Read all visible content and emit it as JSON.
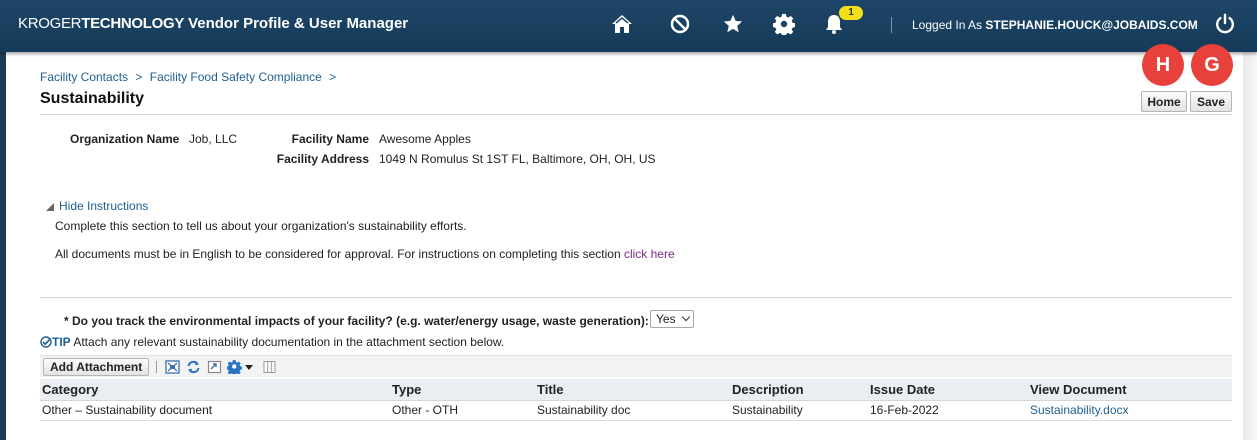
{
  "header": {
    "brand_kroger": "KROGER",
    "brand_tech": "TECHNOLOGY",
    "app_title": "Vendor Profile & User Manager",
    "notification_count": "1",
    "logged_in_label": "Logged In As",
    "user": "STEPHANIE.HOUCK@JOBAIDS.COM",
    "icons": [
      "home-icon",
      "no-entry-icon",
      "star-icon",
      "gear-icon",
      "bell-icon",
      "power-icon"
    ],
    "color": "#1e4668"
  },
  "breadcrumb": {
    "items": [
      "Facility Contacts",
      "Facility Food Safety Compliance"
    ],
    "separator": ">"
  },
  "page": {
    "title": "Sustainability"
  },
  "markers": {
    "home": "H",
    "save": "G",
    "color": "#e8403a"
  },
  "buttons": {
    "home": "Home",
    "save": "Save"
  },
  "info": {
    "org_name_label": "Organization Name",
    "org_name": "Job, LLC",
    "facility_name_label": "Facility Name",
    "facility_name": "Awesome Apples",
    "facility_address_label": "Facility Address",
    "facility_address": "1049 N Romulus St 1ST FL, Baltimore, OH, OH, US"
  },
  "instructions": {
    "toggle": "Hide Instructions",
    "line1": "Complete this section to tell us about your organization's sustainability efforts.",
    "line2": "All documents must be in English to be considered for approval. For instructions on completing this section",
    "link": "click here"
  },
  "question": {
    "text": "* Do you track the environmental impacts of your facility? (e.g. water/energy usage, waste generation):",
    "selected": "Yes"
  },
  "tip": {
    "label": "TIP",
    "text": "Attach any relevant sustainability documentation in the attachment section below."
  },
  "toolbar": {
    "add_attachment": "Add Attachment",
    "icons": [
      "detach-icon",
      "refresh-icon",
      "export-icon",
      "settings-icon",
      "dropdown-icon",
      "columns-icon"
    ]
  },
  "table": {
    "columns": [
      "Category",
      "Type",
      "Title",
      "Description",
      "Issue Date",
      "View Document"
    ],
    "rows": [
      [
        "Other – Sustainability document",
        "Other - OTH",
        "Sustainability doc",
        "Sustainability",
        "16-Feb-2022",
        "Sustainability.docx"
      ]
    ]
  }
}
